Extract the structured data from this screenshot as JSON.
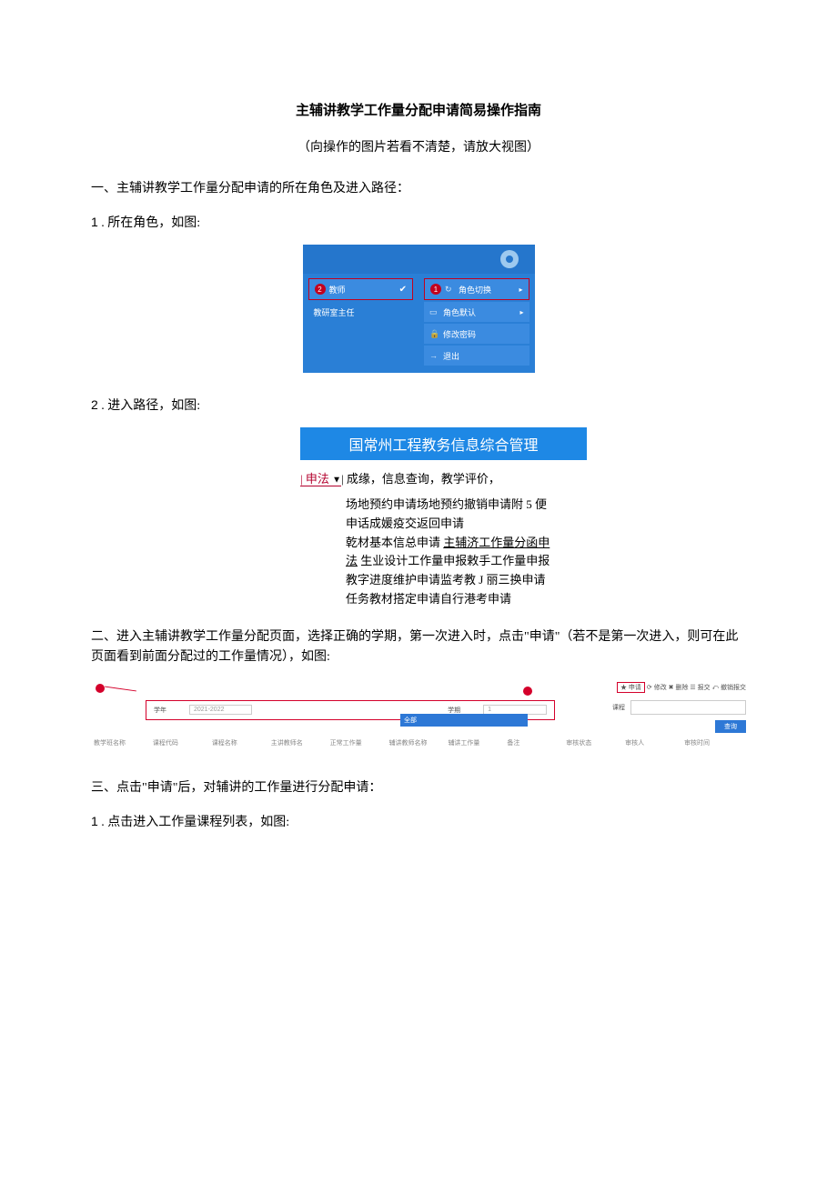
{
  "title": "主辅讲教学工作量分配申请简易操作指南",
  "subtitle": "（向操作的图片若看不清楚，请放大视图）",
  "section1_heading": "一、主辅讲教学工作量分配申请的所在角色及进入路径：",
  "step1": {
    "num": "1",
    "text": " . 所在角色，如图:"
  },
  "fig1": {
    "badge2": "2",
    "role_teacher": "教师",
    "role_office": "教研室主任",
    "badge1": "1",
    "menu_role_switch": "角色切换",
    "menu_role_default": "角色默认",
    "menu_change_pwd": "修改密码",
    "menu_exit": "退出"
  },
  "step2": {
    "num": "2",
    "text": " . 进入路径，如图:"
  },
  "fig2": {
    "banner": "国常州工程教务信息综合管理",
    "nav_left": "| 申法",
    "nav_marker": "▼",
    "nav_right": "| 成缘，信息查询，教学评价，",
    "line1": "场地预约申请场地预约撤销申请附 5 便",
    "line2": "申话成媛疫交返回申请",
    "line3_a": "乾材基本信总申请 ",
    "line3_u": "主辅济工作量分函申",
    "line4_u": "法",
    "line4_b": " 生业设计工作量申报敕手工作量申报",
    "line5": "教字进度维护申请监考教 J 丽三换申请",
    "line6": "任务教材搭定申请自行港考申请"
  },
  "para2": "二、进入主辅讲教学工作量分配页面，选择正确的学期，第一次进入时，点击\"申请\"（若不是第一次进入，则可在此页面看到前面分配过的工作量情况），如图:",
  "fig3": {
    "tools": {
      "apply": "★ 申请",
      "rest": "  ⟳ 修改   ✖ 删除   ☰ 报交   ⤺ 撤销报交"
    },
    "filter_label1": "学年",
    "year": "2021-2022",
    "filter_label2": "学期",
    "sem_sel": "1",
    "sem_opt": "全部",
    "filter_label3": "课程",
    "search_btn": "查询",
    "th": [
      "教学班名称",
      "课程代码",
      "课程名称",
      "主讲教师名",
      "正常工作量",
      "辅讲教师名称",
      "辅讲工作量",
      "备注",
      "审核状态",
      "审核人",
      "审核时间"
    ]
  },
  "section3_heading": "三、点击\"申请\"后，对辅讲的工作量进行分配申请：",
  "step3_1": {
    "num": "1",
    "text": " . 点击进入工作量课程列表，如图:"
  }
}
